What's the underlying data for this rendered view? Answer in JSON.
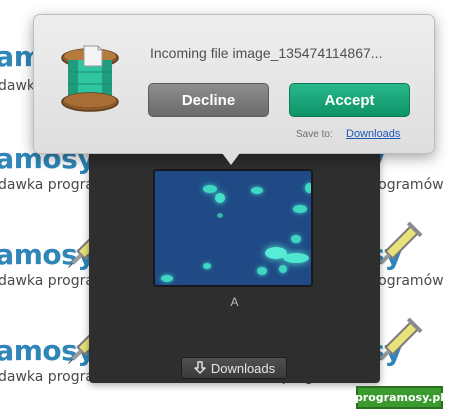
{
  "watermark": {
    "logo_text": "programosy",
    "logo_fragment": "ramosy",
    "tagline": "dawka programów",
    "tagline_center": "na dawka programów"
  },
  "popover": {
    "title": "Incoming file image_135474114867...",
    "decline_label": "Decline",
    "accept_label": "Accept",
    "save_to_label": "Save to:",
    "save_to_location": "Downloads",
    "icon": "file-spool-icon"
  },
  "share_panel": {
    "thumbnail_label": "A",
    "downloads_button_label": "Downloads",
    "downloads_icon": "download-arrow-icon"
  },
  "badge": {
    "text": "programosy.pl"
  },
  "colors": {
    "accept": "#1aa679",
    "decline": "#7a7a7a",
    "panel": "#2e2e2e",
    "thumbnail_bg": "#1f4a86",
    "link": "#1f58b9",
    "watermark_logo": "#2f86b8",
    "badge": "#3a9a2e"
  }
}
